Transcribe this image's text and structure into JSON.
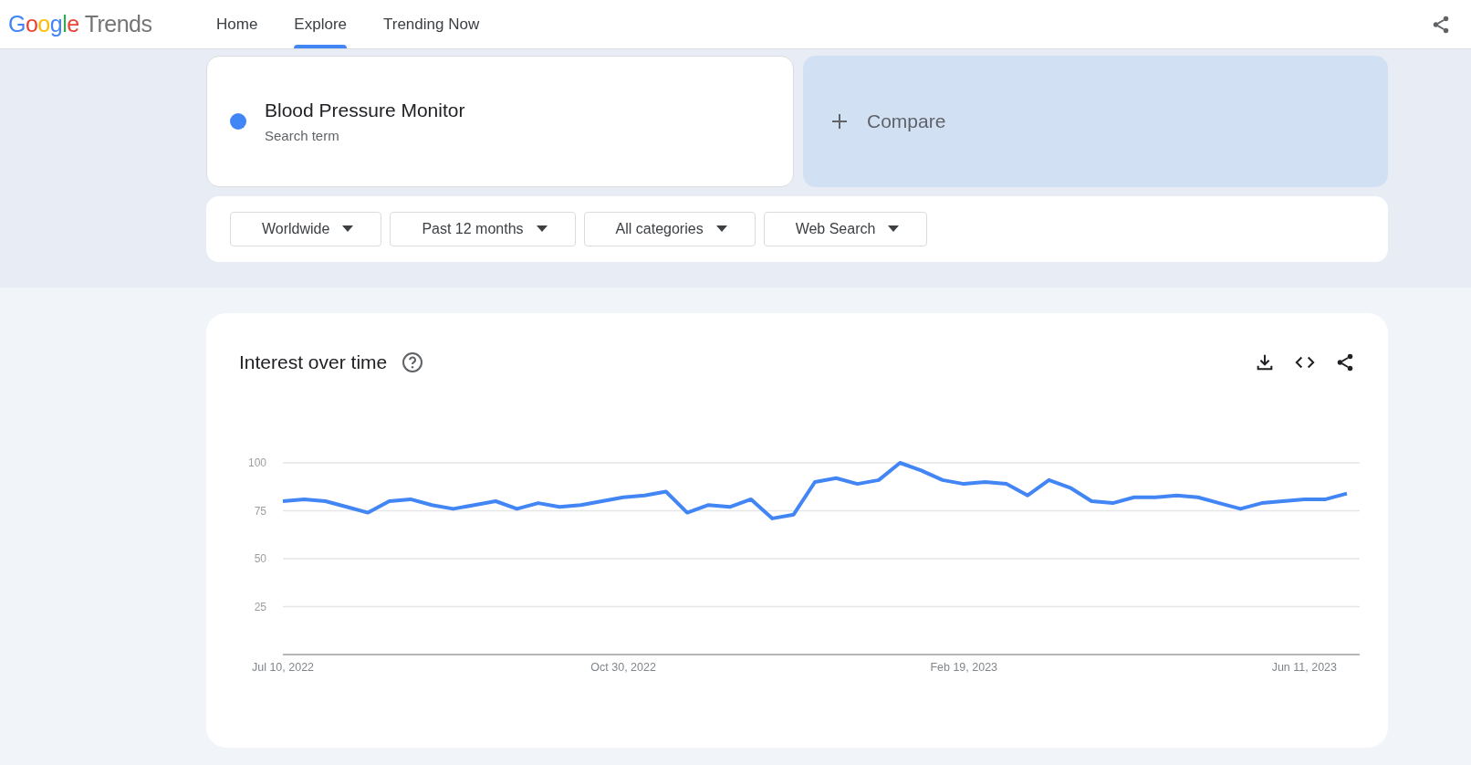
{
  "header": {
    "logo": {
      "brand": "Google",
      "product": "Trends"
    },
    "nav": [
      {
        "label": "Home",
        "selected": false
      },
      {
        "label": "Explore",
        "selected": true
      },
      {
        "label": "Trending Now",
        "selected": false
      }
    ]
  },
  "search": {
    "term": "Blood Pressure Monitor",
    "subtitle": "Search term",
    "color": "#4285f4"
  },
  "compare": {
    "label": "Compare"
  },
  "filters": [
    {
      "label": "Worldwide"
    },
    {
      "label": "Past 12 months"
    },
    {
      "label": "All categories"
    },
    {
      "label": "Web Search"
    }
  ],
  "interest_over_time": {
    "title": "Interest over time",
    "chart_data": {
      "type": "line",
      "categories": [
        "Jul 10, 2022",
        null,
        null,
        null,
        null,
        null,
        null,
        null,
        null,
        null,
        null,
        null,
        null,
        null,
        null,
        null,
        "Oct 30, 2022",
        null,
        null,
        null,
        null,
        null,
        null,
        null,
        null,
        null,
        null,
        null,
        null,
        null,
        null,
        null,
        "Feb 19, 2023",
        null,
        null,
        null,
        null,
        null,
        null,
        null,
        null,
        null,
        null,
        null,
        null,
        null,
        null,
        null,
        "Jun 11, 2023",
        null,
        null
      ],
      "series": [
        {
          "color": "#4285f4",
          "values": [
            80,
            81,
            80,
            77,
            74,
            80,
            81,
            78,
            76,
            78,
            80,
            76,
            79,
            77,
            78,
            80,
            82,
            83,
            85,
            74,
            78,
            77,
            81,
            71,
            73,
            90,
            92,
            89,
            91,
            100,
            96,
            91,
            89,
            90,
            89,
            83,
            91,
            87,
            80,
            79,
            82,
            82,
            83,
            82,
            79,
            76,
            79,
            80,
            81,
            81,
            84
          ]
        }
      ],
      "ylim": [
        0,
        100
      ],
      "yticks": [
        25,
        50,
        75,
        100
      ],
      "grid": true
    }
  }
}
